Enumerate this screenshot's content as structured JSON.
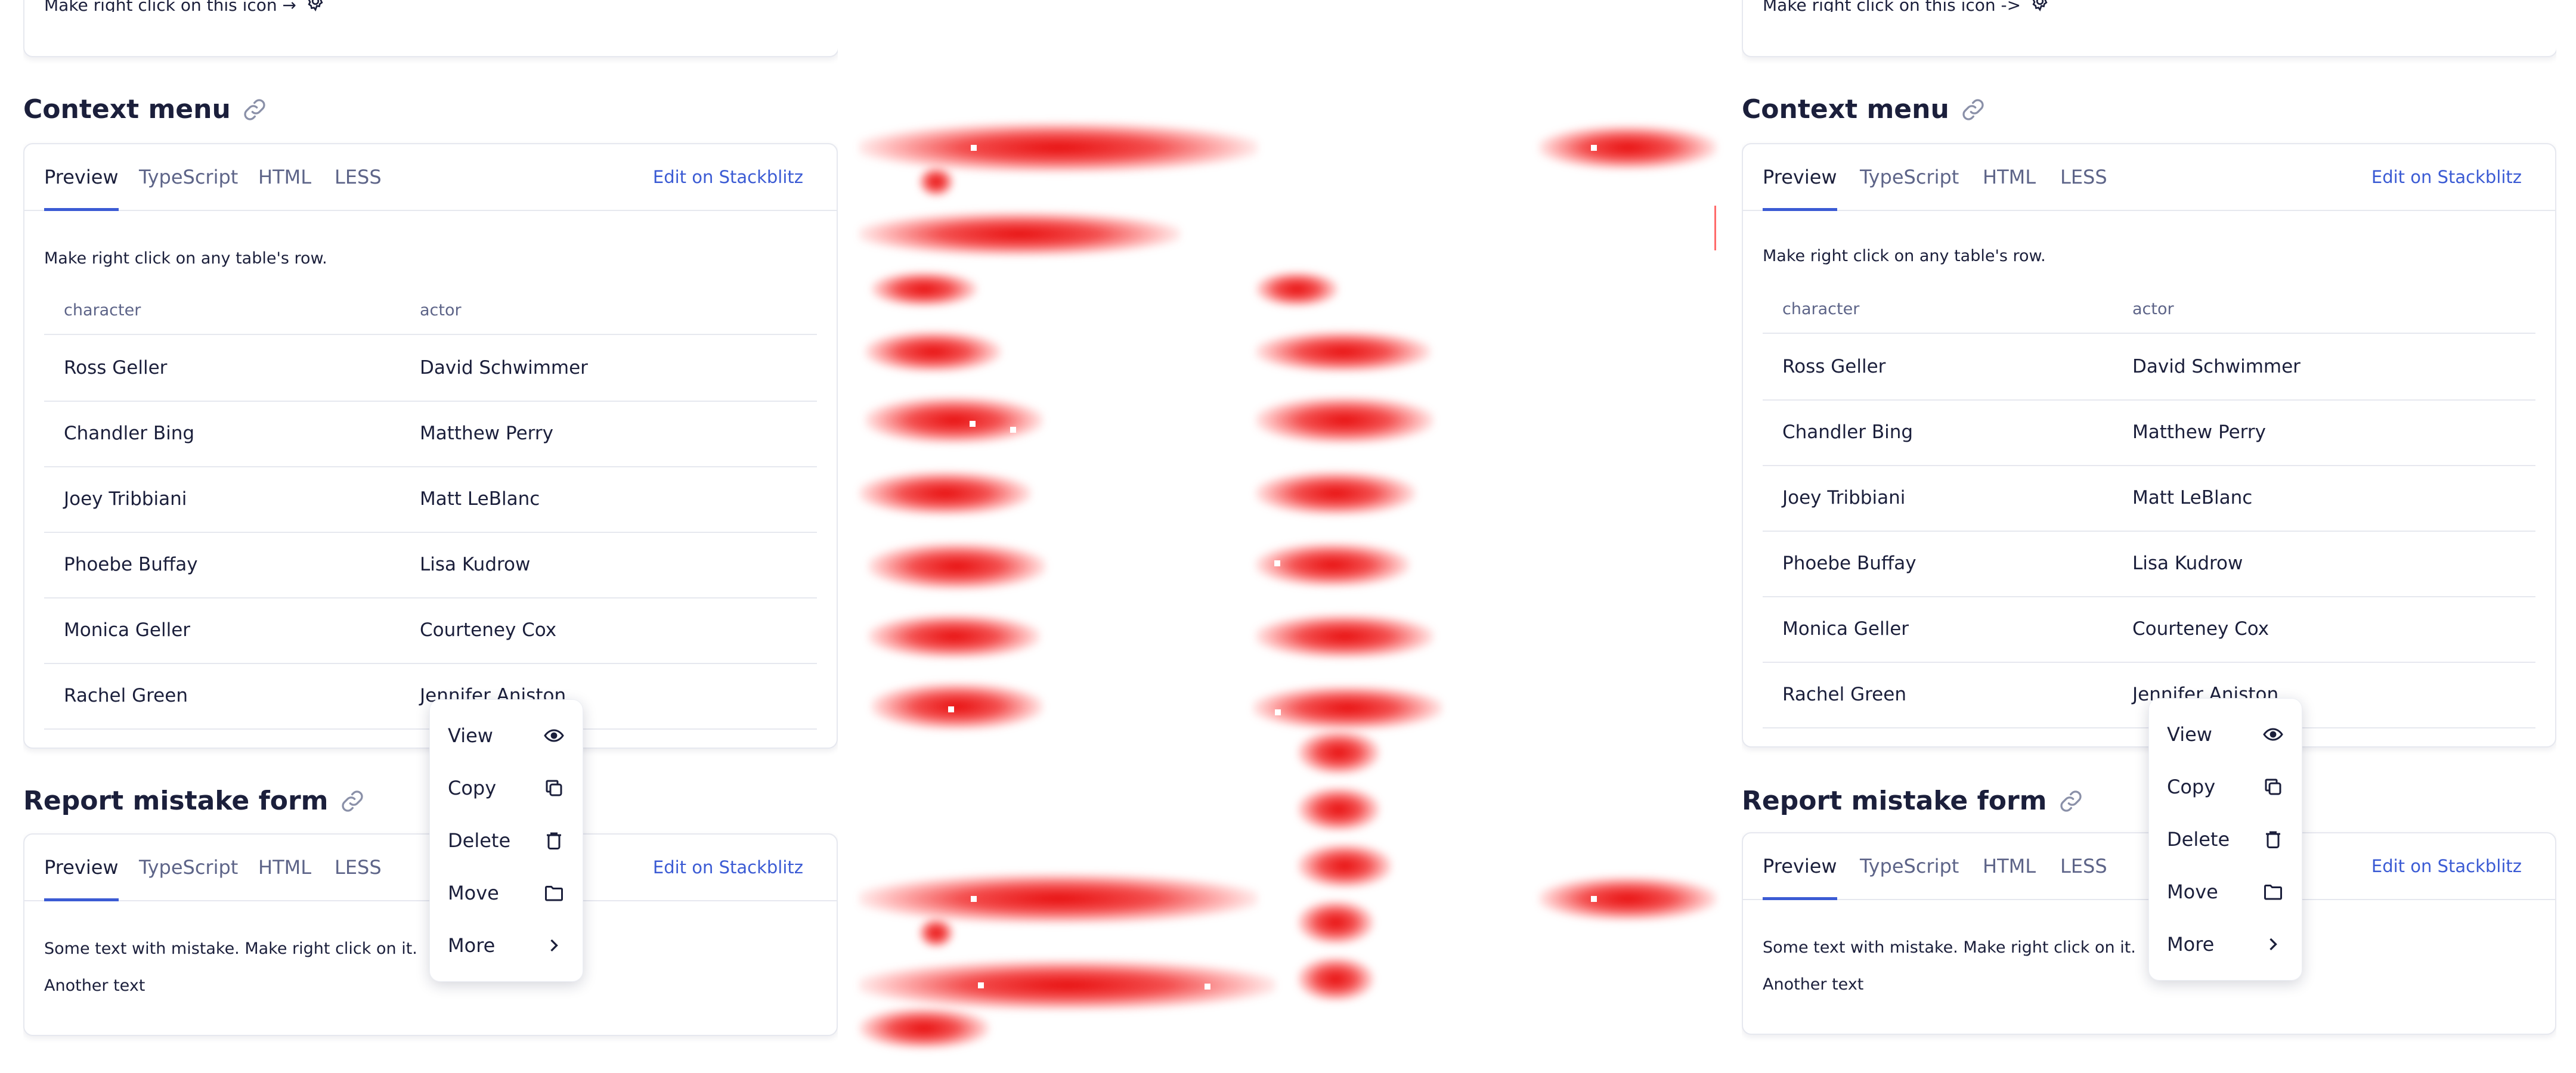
{
  "top_fragment": {
    "text_left": "Make right click on this icon →",
    "text_right": "Make right click on this icon ->"
  },
  "panels": {
    "left": {
      "context_section": {
        "title": "Context menu",
        "tabs": [
          "Preview",
          "TypeScript",
          "HTML",
          "LESS"
        ],
        "active_tab": "Preview",
        "stackblitz": "Edit on Stackblitz",
        "description": "Make right click on any table's row.",
        "columns": [
          "character",
          "actor"
        ],
        "rows": [
          [
            "Ross Geller",
            "David Schwimmer"
          ],
          [
            "Chandler Bing",
            "Matthew Perry"
          ],
          [
            "Joey Tribbiani",
            "Matt LeBlanc"
          ],
          [
            "Phoebe Buffay",
            "Lisa Kudrow"
          ],
          [
            "Monica Geller",
            "Courteney Cox"
          ],
          [
            "Rachel Green",
            "Jennifer Aniston"
          ]
        ]
      },
      "report_section": {
        "title": "Report mistake form",
        "tabs": [
          "Preview",
          "TypeScript",
          "HTML",
          "LESS"
        ],
        "stackblitz": "Edit on Stackblitz",
        "line1": "Some text with mistake. Make right click on it.",
        "line2": "Another text"
      },
      "context_menu": {
        "items": [
          {
            "label": "View",
            "icon": "eye-icon"
          },
          {
            "label": "Copy",
            "icon": "copy-icon"
          },
          {
            "label": "Delete",
            "icon": "trash-icon"
          },
          {
            "label": "Move",
            "icon": "folder-icon"
          },
          {
            "label": "More",
            "icon": "chevron-right-icon"
          }
        ]
      }
    },
    "right": {
      "context_section": {
        "title": "Context menu",
        "tabs": [
          "Preview",
          "TypeScript",
          "HTML",
          "LESS"
        ],
        "active_tab": "Preview",
        "stackblitz": "Edit on Stackblitz",
        "description": "Make right click on any table's row.",
        "columns": [
          "character",
          "actor"
        ],
        "rows": [
          [
            "Ross Geller",
            "David Schwimmer"
          ],
          [
            "Chandler Bing",
            "Matthew Perry"
          ],
          [
            "Joey Tribbiani",
            "Matt LeBlanc"
          ],
          [
            "Phoebe Buffay",
            "Lisa Kudrow"
          ],
          [
            "Monica Geller",
            "Courteney Cox"
          ],
          [
            "Rachel Green",
            "Jennifer Aniston"
          ]
        ]
      },
      "report_section": {
        "title": "Report mistake form",
        "tabs": [
          "Preview",
          "TypeScript",
          "HTML",
          "LESS"
        ],
        "stackblitz": "Edit on Stackblitz",
        "line1": "Some text with mistake. Make right click on it.",
        "line2": "Another text"
      },
      "context_menu": {
        "items": [
          {
            "label": "View",
            "icon": "eye-icon"
          },
          {
            "label": "Copy",
            "icon": "copy-icon"
          },
          {
            "label": "Delete",
            "icon": "trash-icon"
          },
          {
            "label": "Move",
            "icon": "folder-icon"
          },
          {
            "label": "More",
            "icon": "chevron-right-icon"
          }
        ]
      }
    }
  },
  "colors": {
    "accent": "#3b5bd4",
    "text": "#1b1f3b",
    "muted": "#5d6488",
    "border": "#e6e8ef",
    "heat": "#e60000"
  }
}
